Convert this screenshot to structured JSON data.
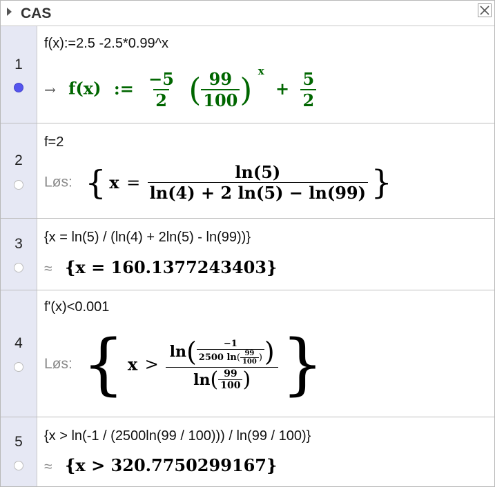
{
  "header": {
    "title": "CAS",
    "close_icon": "close-x-icon"
  },
  "rows": [
    {
      "num": "1",
      "input": "f(x):=2.5 -2.5*0.99^x",
      "output": {
        "arrow": "→",
        "lhs": "f(x)",
        "assign": ":=",
        "a_num": "−5",
        "a_den": "2",
        "b_num": "99",
        "b_den": "100",
        "exp": "x",
        "plus": "+",
        "c_num": "5",
        "c_den": "2"
      },
      "status_color": "#5555ee"
    },
    {
      "num": "2",
      "input": "f=2",
      "output": {
        "label": "Løs:",
        "var": "x",
        "rel": "=",
        "num": "ln(5)",
        "den": "ln(4) + 2 ln(5) − ln(99)"
      }
    },
    {
      "num": "3",
      "input": "{x = ln(5) / (ln(4) + 2ln(5) - ln(99))}",
      "output": {
        "symbol": "≈",
        "text": "{x = 160.1377243403}"
      }
    },
    {
      "num": "4",
      "input": "f'(x)<0.001",
      "output": {
        "label": "Løs:",
        "var": "x",
        "rel": ">",
        "ln": "ln",
        "inner_num": "−1",
        "inner_den_prefix": "2500 ln",
        "tiny_num": "99",
        "tiny_den": "100",
        "den_ln": "ln",
        "den_num": "99",
        "den_den": "100"
      }
    },
    {
      "num": "5",
      "input": "{x > ln(-1 / (2500ln(99 / 100))) / ln(99 / 100)}",
      "output": {
        "symbol": "≈",
        "text": "{x > 320.7750299167}"
      }
    }
  ]
}
